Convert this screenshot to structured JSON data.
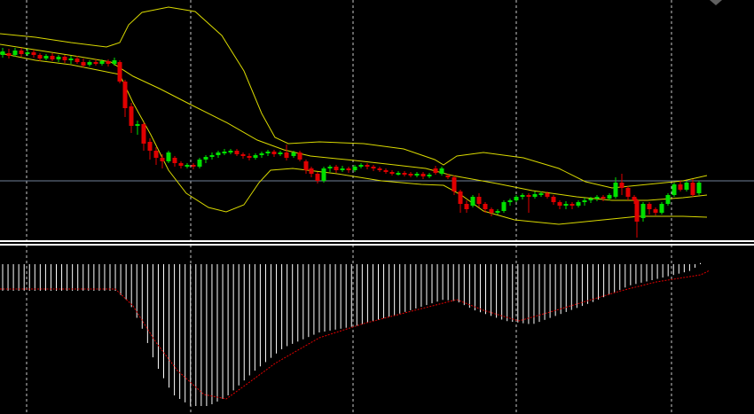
{
  "colors": {
    "background": "#000000",
    "bull": "#00e000",
    "bear": "#e00000",
    "wick": "#b0b0b0",
    "bands": "#d9d900",
    "grid": "#c8c8c8",
    "hline": "#6f7f99",
    "separator": "#ffffff",
    "histogram": "#ffffff",
    "signal": "#e00000"
  },
  "chart_data": [
    {
      "type": "candlestick",
      "ylim": [
        20,
        260
      ],
      "grid_x": [
        30,
        215,
        398,
        582,
        757
      ],
      "grid": "vertical-dashed",
      "horizontal_line": 204,
      "candles": [
        [
          3,
          62,
          58,
          65,
          54
        ],
        [
          10,
          60,
          63,
          66,
          55
        ],
        [
          17,
          62,
          57,
          64,
          54
        ],
        [
          24,
          57,
          61,
          64,
          54
        ],
        [
          31,
          60,
          59,
          63,
          55
        ],
        [
          38,
          59,
          62,
          65,
          56
        ],
        [
          45,
          62,
          66,
          69,
          60
        ],
        [
          52,
          66,
          63,
          68,
          61
        ],
        [
          59,
          63,
          67,
          69,
          60
        ],
        [
          66,
          67,
          64,
          70,
          62
        ],
        [
          73,
          64,
          68,
          71,
          62
        ],
        [
          80,
          68,
          66,
          72,
          63
        ],
        [
          87,
          66,
          70,
          72,
          63
        ],
        [
          94,
          70,
          74,
          76,
          66
        ],
        [
          101,
          73,
          70,
          75,
          68
        ],
        [
          108,
          70,
          72,
          74,
          67
        ],
        [
          115,
          72,
          69,
          74,
          67
        ],
        [
          122,
          69,
          72,
          75,
          67
        ],
        [
          129,
          72,
          68,
          74,
          65
        ],
        [
          135,
          70,
          92,
          94,
          68
        ],
        [
          141,
          92,
          122,
          132,
          90
        ],
        [
          148,
          120,
          142,
          150,
          116
        ],
        [
          155,
          142,
          140,
          152,
          136
        ],
        [
          162,
          140,
          162,
          170,
          138
        ],
        [
          169,
          160,
          170,
          180,
          156
        ],
        [
          176,
          170,
          178,
          186,
          166
        ],
        [
          183,
          178,
          182,
          190,
          174
        ],
        [
          190,
          182,
          172,
          184,
          170
        ],
        [
          197,
          178,
          184,
          188,
          176
        ],
        [
          204,
          184,
          187,
          190,
          182
        ],
        [
          211,
          187,
          186,
          190,
          184
        ],
        [
          218,
          186,
          188,
          191,
          184
        ],
        [
          225,
          188,
          180,
          190,
          178
        ],
        [
          232,
          180,
          177,
          184,
          175
        ],
        [
          239,
          177,
          175,
          180,
          172
        ],
        [
          246,
          175,
          172,
          178,
          170
        ],
        [
          253,
          172,
          171,
          175,
          168
        ],
        [
          260,
          171,
          170,
          174,
          168
        ],
        [
          267,
          170,
          174,
          176,
          168
        ],
        [
          274,
          174,
          176,
          179,
          172
        ],
        [
          281,
          176,
          178,
          181,
          173
        ],
        [
          288,
          178,
          175,
          180,
          173
        ],
        [
          295,
          175,
          173,
          178,
          171
        ],
        [
          302,
          173,
          171,
          176,
          169
        ],
        [
          309,
          171,
          174,
          177,
          169
        ],
        [
          316,
          174,
          172,
          176,
          170
        ],
        [
          323,
          172,
          178,
          181,
          163
        ],
        [
          331,
          176,
          172,
          178,
          170
        ],
        [
          338,
          172,
          180,
          182,
          170
        ],
        [
          345,
          182,
          192,
          196,
          180
        ],
        [
          351,
          190,
          196,
          200,
          188
        ],
        [
          358,
          196,
          204,
          207,
          194
        ],
        [
          365,
          204,
          190,
          206,
          188
        ],
        [
          372,
          190,
          188,
          194,
          186
        ],
        [
          379,
          188,
          192,
          195,
          186
        ],
        [
          386,
          192,
          190,
          194,
          187
        ],
        [
          393,
          190,
          192,
          195,
          188
        ],
        [
          400,
          192,
          188,
          194,
          186
        ],
        [
          407,
          188,
          186,
          190,
          184
        ],
        [
          414,
          186,
          188,
          191,
          184
        ],
        [
          421,
          188,
          190,
          193,
          186
        ],
        [
          428,
          190,
          192,
          194,
          188
        ],
        [
          435,
          192,
          194,
          196,
          190
        ],
        [
          442,
          194,
          196,
          198,
          192
        ],
        [
          449,
          196,
          195,
          198,
          193
        ],
        [
          456,
          195,
          196,
          199,
          193
        ],
        [
          463,
          196,
          198,
          200,
          194
        ],
        [
          470,
          198,
          196,
          200,
          194
        ],
        [
          477,
          196,
          199,
          202,
          194
        ],
        [
          484,
          199,
          197,
          201,
          195
        ],
        [
          491,
          190,
          195,
          197,
          187
        ],
        [
          498,
          196,
          190,
          198,
          188
        ],
        [
          505,
          198,
          200,
          202,
          196
        ],
        [
          512,
          200,
          216,
          220,
          198
        ],
        [
          519,
          216,
          230,
          240,
          214
        ],
        [
          526,
          230,
          236,
          240,
          226
        ],
        [
          533,
          232,
          222,
          234,
          220
        ],
        [
          540,
          222,
          230,
          234,
          218
        ],
        [
          547,
          230,
          236,
          240,
          228
        ],
        [
          554,
          236,
          240,
          244,
          234
        ],
        [
          561,
          240,
          238,
          242,
          236
        ],
        [
          568,
          238,
          228,
          240,
          226
        ],
        [
          575,
          228,
          226,
          232,
          224
        ],
        [
          582,
          226,
          222,
          228,
          220
        ],
        [
          589,
          222,
          220,
          225,
          218
        ],
        [
          596,
          220,
          222,
          240,
          218
        ],
        [
          603,
          222,
          219,
          224,
          216
        ],
        [
          610,
          219,
          218,
          222,
          216
        ],
        [
          617,
          218,
          222,
          224,
          216
        ],
        [
          624,
          222,
          228,
          231,
          220
        ],
        [
          631,
          228,
          232,
          236,
          226
        ],
        [
          638,
          232,
          230,
          236,
          227
        ],
        [
          645,
          230,
          232,
          236,
          228
        ],
        [
          652,
          232,
          228,
          234,
          226
        ],
        [
          659,
          228,
          226,
          232,
          223
        ],
        [
          666,
          226,
          224,
          229,
          222
        ],
        [
          673,
          224,
          222,
          227,
          220
        ],
        [
          680,
          222,
          224,
          227,
          220
        ],
        [
          687,
          224,
          220,
          226,
          218
        ],
        [
          694,
          222,
          206,
          224,
          200
        ],
        [
          701,
          206,
          212,
          220,
          196
        ],
        [
          708,
          212,
          222,
          226,
          210
        ],
        [
          715,
          222,
          226,
          230,
          220
        ],
        [
          718,
          226,
          250,
          268,
          224
        ],
        [
          725,
          246,
          230,
          250,
          228
        ],
        [
          732,
          230,
          236,
          242,
          228
        ],
        [
          739,
          236,
          240,
          243,
          234
        ],
        [
          746,
          240,
          230,
          242,
          228
        ],
        [
          753,
          230,
          220,
          232,
          218
        ],
        [
          760,
          220,
          208,
          222,
          206
        ],
        [
          767,
          208,
          214,
          216,
          204
        ],
        [
          774,
          214,
          206,
          216,
          204
        ],
        [
          781,
          206,
          220,
          222,
          202
        ],
        [
          788,
          218,
          206,
          220,
          204
        ]
      ],
      "bollinger_upper": [
        [
          0,
          38
        ],
        [
          40,
          42
        ],
        [
          80,
          48
        ],
        [
          120,
          53
        ],
        [
          135,
          48
        ],
        [
          145,
          28
        ],
        [
          160,
          14
        ],
        [
          190,
          8
        ],
        [
          220,
          13
        ],
        [
          250,
          40
        ],
        [
          275,
          80
        ],
        [
          295,
          128
        ],
        [
          310,
          155
        ],
        [
          325,
          162
        ],
        [
          360,
          160
        ],
        [
          410,
          162
        ],
        [
          455,
          168
        ],
        [
          490,
          180
        ],
        [
          500,
          186
        ],
        [
          515,
          176
        ],
        [
          545,
          172
        ],
        [
          590,
          178
        ],
        [
          630,
          190
        ],
        [
          660,
          205
        ],
        [
          690,
          212
        ],
        [
          740,
          207
        ],
        [
          770,
          204
        ],
        [
          797,
          198
        ]
      ],
      "bollinger_middle": [
        [
          0,
          50
        ],
        [
          45,
          57
        ],
        [
          90,
          64
        ],
        [
          125,
          70
        ],
        [
          150,
          86
        ],
        [
          180,
          100
        ],
        [
          215,
          118
        ],
        [
          255,
          138
        ],
        [
          290,
          158
        ],
        [
          320,
          169
        ],
        [
          350,
          176
        ],
        [
          400,
          181
        ],
        [
          445,
          186
        ],
        [
          480,
          190
        ],
        [
          510,
          198
        ],
        [
          560,
          207
        ],
        [
          600,
          215
        ],
        [
          650,
          222
        ],
        [
          690,
          226
        ],
        [
          730,
          226
        ],
        [
          770,
          223
        ],
        [
          797,
          220
        ]
      ],
      "bollinger_lower": [
        [
          0,
          60
        ],
        [
          40,
          68
        ],
        [
          80,
          73
        ],
        [
          115,
          80
        ],
        [
          135,
          84
        ],
        [
          150,
          116
        ],
        [
          170,
          152
        ],
        [
          190,
          192
        ],
        [
          210,
          218
        ],
        [
          235,
          234
        ],
        [
          255,
          239
        ],
        [
          275,
          231
        ],
        [
          292,
          206
        ],
        [
          305,
          192
        ],
        [
          330,
          190
        ],
        [
          380,
          196
        ],
        [
          430,
          204
        ],
        [
          475,
          208
        ],
        [
          500,
          209
        ],
        [
          520,
          220
        ],
        [
          545,
          238
        ],
        [
          580,
          248
        ],
        [
          630,
          253
        ],
        [
          680,
          248
        ],
        [
          720,
          244
        ],
        [
          770,
          244
        ],
        [
          797,
          245
        ]
      ]
    },
    {
      "type": "histogram",
      "zero_line": 298,
      "bar_start_x": 3,
      "bar_step": 6.05,
      "bar_count": 131,
      "histogram_shape": [
        [
          0,
          328
        ],
        [
          130,
          328
        ],
        [
          145,
          340
        ],
        [
          160,
          370
        ],
        [
          175,
          410
        ],
        [
          195,
          445
        ],
        [
          215,
          458
        ],
        [
          235,
          458
        ],
        [
          255,
          448
        ],
        [
          285,
          420
        ],
        [
          320,
          392
        ],
        [
          360,
          375
        ],
        [
          400,
          368
        ],
        [
          450,
          354
        ],
        [
          500,
          338
        ],
        [
          515,
          340
        ],
        [
          535,
          350
        ],
        [
          570,
          362
        ],
        [
          600,
          366
        ],
        [
          630,
          355
        ],
        [
          670,
          340
        ],
        [
          710,
          322
        ],
        [
          760,
          310
        ],
        [
          780,
          305
        ],
        [
          795,
          292
        ],
        [
          800,
          288
        ]
      ],
      "signal_line": [
        [
          0,
          326
        ],
        [
          130,
          326
        ],
        [
          150,
          345
        ],
        [
          175,
          385
        ],
        [
          200,
          418
        ],
        [
          230,
          445
        ],
        [
          255,
          450
        ],
        [
          280,
          432
        ],
        [
          310,
          410
        ],
        [
          360,
          381
        ],
        [
          410,
          365
        ],
        [
          460,
          352
        ],
        [
          515,
          338
        ],
        [
          545,
          350
        ],
        [
          585,
          362
        ],
        [
          620,
          352
        ],
        [
          660,
          340
        ],
        [
          700,
          328
        ],
        [
          740,
          318
        ],
        [
          790,
          310
        ],
        [
          800,
          305
        ]
      ]
    }
  ]
}
